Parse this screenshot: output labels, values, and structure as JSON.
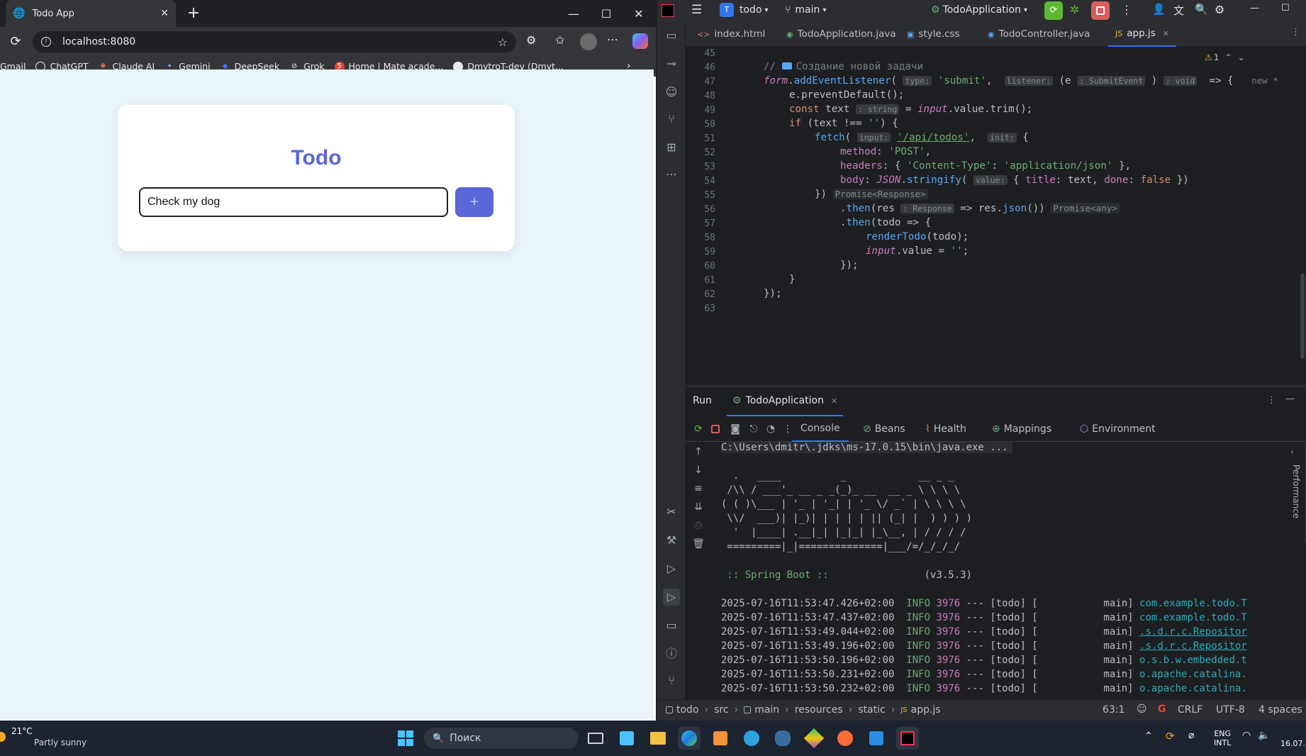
{
  "browser": {
    "tab_title": "Todo App",
    "address": "localhost:8080",
    "bookmarks": [
      "Gmail",
      "ChatGPT",
      "Claude AI",
      "Gemini",
      "DeepSeek",
      "Grok",
      "Home | Mate acade...",
      "DmytroT-dev (Dmyt..."
    ],
    "bookmark_badge": "5"
  },
  "todo_app": {
    "title": "Todo",
    "input_value": "Check my dog",
    "add_label": "+"
  },
  "ide": {
    "project": "todo",
    "project_badge": "T",
    "branch": "main",
    "run_config": "TodoApplication",
    "tabs": [
      "index.html",
      "TodoApplication.java",
      "style.css",
      "TodoController.java",
      "app.js"
    ],
    "warning_count": "1",
    "line_numbers": [
      "45",
      "46",
      "47",
      "48",
      "49",
      "50",
      "51",
      "52",
      "53",
      "54",
      "55",
      "56",
      "57",
      "58",
      "59",
      "60",
      "61",
      "62",
      "63"
    ],
    "code": {
      "l46_comment": "// ",
      "l46_text": "Создание новой задачи",
      "l47_a": "form",
      "l47_b": ".",
      "l47_c": "addEventListener",
      "l47_d": "(",
      "l47_hint1": "type:",
      "l47_e": "'submit'",
      "l47_f": ",",
      "l47_hint2": "listener:",
      "l47_g": "(e",
      "l47_hint3": ": SubmitEvent",
      "l47_h": ")",
      "l47_hint4": ": void",
      "l47_i": " => {",
      "l47_new": "new *",
      "l48": "e.preventDefault();",
      "l49_kw": "const",
      "l49_var": " text",
      "l49_hint": ": string",
      "l49_eq": " = ",
      "l49_input": "input",
      "l49_rest": ".value.trim();",
      "l50_kw": "if",
      "l50_a": " (text !== ",
      "l50_str": "''",
      "l50_b": ") {",
      "l51_fn": "fetch",
      "l51_a": "(",
      "l51_hint1": "input:",
      "l51_url": "'/api/todos'",
      "l51_b": ",",
      "l51_hint2": "init:",
      "l51_c": "{",
      "l52_key": "method",
      "l52_a": ": ",
      "l52_str": "'POST'",
      "l52_b": ",",
      "l53_key": "headers",
      "l53_a": ": { ",
      "l53_str1": "'Content-Type'",
      "l53_b": ": ",
      "l53_str2": "'application/json'",
      "l53_c": " },",
      "l54_key": "body",
      "l54_a": ": ",
      "l54_json": "JSON",
      "l54_b": ".",
      "l54_fn": "stringify",
      "l54_c": "(",
      "l54_hint": "value:",
      "l54_d": "{ ",
      "l54_k1": "title",
      "l54_e": ": text, ",
      "l54_k2": "done",
      "l54_f": ": ",
      "l54_false": "false",
      "l54_g": " })",
      "l55_a": "})",
      "l55_ret": "Promise<Response>",
      "l56_a": ".",
      "l56_fn": "then",
      "l56_b": "(res",
      "l56_hint": ": Response",
      "l56_c": " => res.",
      "l56_fn2": "json",
      "l56_d": "())",
      "l56_ret": "Promise<any>",
      "l57_a": ".",
      "l57_fn": "then",
      "l57_b": "(todo => {",
      "l58_fn": "renderTodo",
      "l58_a": "(todo);",
      "l59_input": "input",
      "l59_a": ".value = ",
      "l59_str": "''",
      "l59_b": ";",
      "l60": "});",
      "l61": "}",
      "l62": "});"
    },
    "run": {
      "label": "Run",
      "config_tab": "TodoApplication",
      "tabs": [
        "Console",
        "Beans",
        "Health",
        "Mappings",
        "Environment"
      ],
      "command": "C:\\Users\\dmitr\\.jdks\\ms-17.0.15\\bin\\java.exe ...",
      "banner": [
        "  .   ____          _            __ _ _",
        " /\\\\ / ___'_ __ _ _(_)_ __  __ _ \\ \\ \\ \\",
        "( ( )\\___ | '_ | '_| | '_ \\/ _` | \\ \\ \\ \\",
        " \\\\/  ___)| |_)| | | | | || (_| |  ) ) ) )",
        "  '  |____| .__|_| |_|_| |_\\__, | / / / /",
        " =========|_|==============|___/=/_/_/_/"
      ],
      "spring_label": " :: Spring Boot ::",
      "spring_version": "(v3.5.3)",
      "logs": [
        {
          "ts": "2025-07-16T11:53:47.426+02:00",
          "level": "INFO",
          "pid": "3976",
          "rest": " --- [todo] [           main] ",
          "logger": "com.example.todo.T"
        },
        {
          "ts": "2025-07-16T11:53:47.437+02:00",
          "level": "INFO",
          "pid": "3976",
          "rest": " --- [todo] [           main] ",
          "logger": "com.example.todo.T"
        },
        {
          "ts": "2025-07-16T11:53:49.044+02:00",
          "level": "INFO",
          "pid": "3976",
          "rest": " --- [todo] [           main] ",
          "logger": ".s.d.r.c.Repositor"
        },
        {
          "ts": "2025-07-16T11:53:49.196+02:00",
          "level": "INFO",
          "pid": "3976",
          "rest": " --- [todo] [           main] ",
          "logger": ".s.d.r.c.Repositor"
        },
        {
          "ts": "2025-07-16T11:53:50.196+02:00",
          "level": "INFO",
          "pid": "3976",
          "rest": " --- [todo] [           main] ",
          "logger": "o.s.b.w.embedded.t"
        },
        {
          "ts": "2025-07-16T11:53:50.231+02:00",
          "level": "INFO",
          "pid": "3976",
          "rest": " --- [todo] [           main] ",
          "logger": "o.apache.catalina."
        },
        {
          "ts": "2025-07-16T11:53:50.232+02:00",
          "level": "INFO",
          "pid": "3976",
          "rest": " --- [todo] [           main] ",
          "logger": "o.apache.catalina."
        }
      ],
      "side_label": "Performance"
    },
    "breadcrumb": [
      "todo",
      "src",
      "main",
      "resources",
      "static",
      "app.js"
    ],
    "status": {
      "position": "63:1",
      "line_ending": "CRLF",
      "encoding": "UTF-8",
      "indent": "4 spaces"
    }
  },
  "taskbar": {
    "weather_temp": "21°C",
    "weather_desc": "Partly sunny",
    "search_placeholder": "Поиск",
    "lang_top": "ENG",
    "lang_bottom": "INTL",
    "date": "16.07."
  },
  "colors": {
    "accent": "#5a67d8",
    "ide_accent": "#3574f0",
    "run_green": "#5fb832",
    "stop_red": "#db5c5c"
  }
}
